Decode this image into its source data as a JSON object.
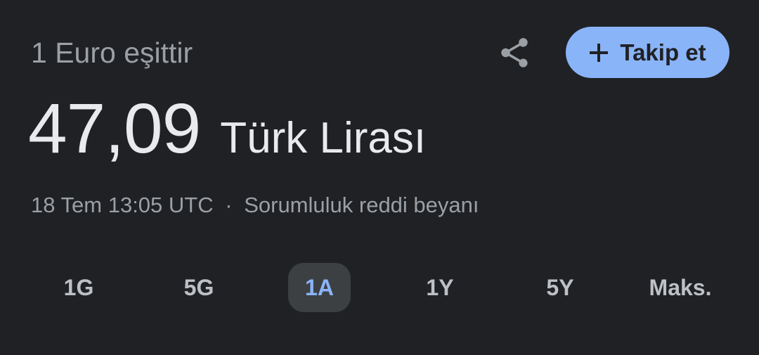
{
  "header": {
    "subtitle": "1 Euro eşittir",
    "share_icon": "share-icon",
    "follow_label": "Takip et",
    "follow_icon": "plus-icon"
  },
  "price": {
    "value": "47,09",
    "unit": "Türk Lirası"
  },
  "meta": {
    "timestamp": "18 Tem 13:05 UTC",
    "separator": "·",
    "disclaimer": "Sorumluluk reddi beyanı"
  },
  "ranges": {
    "items": [
      "1G",
      "5G",
      "1A",
      "1Y",
      "5Y",
      "Maks."
    ],
    "selected": "1A"
  },
  "colors": {
    "background": "#202124",
    "accent": "#8ab4f8",
    "muted_text": "#9aa0a6",
    "active_tab_bg": "#3c4043"
  }
}
